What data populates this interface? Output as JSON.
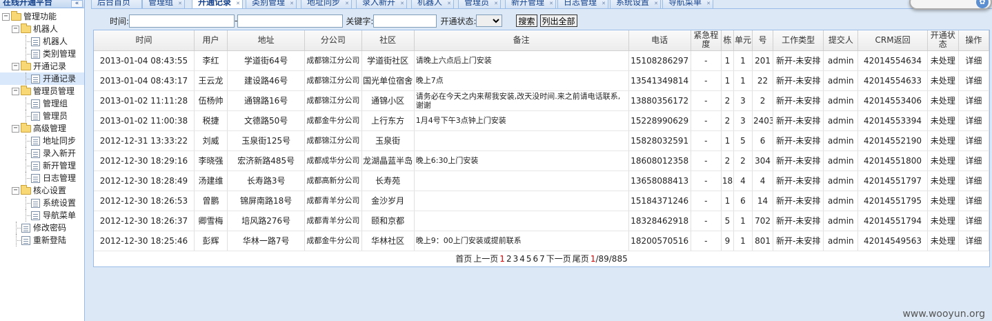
{
  "sidebar": {
    "title": "在线开通平台",
    "collapse_icon": "«",
    "root": "管理功能",
    "groups": [
      {
        "label": "机器人",
        "items": [
          "机器人",
          "类别管理"
        ]
      },
      {
        "label": "开通记录",
        "items": [
          "开通记录"
        ]
      },
      {
        "label": "管理员管理",
        "items": [
          "管理组",
          "管理员"
        ]
      },
      {
        "label": "高级管理",
        "items": [
          "地址同步",
          "录入新开",
          "新开管理",
          "日志管理"
        ]
      },
      {
        "label": "核心设置",
        "items": [
          "系统设置",
          "导航菜单"
        ]
      }
    ],
    "extra": [
      "修改密码",
      "重新登陆"
    ]
  },
  "tabs": [
    "后台首页",
    "管理组",
    "开通记录",
    "类别管理",
    "地址同步",
    "录入新开",
    "机器人",
    "管理员",
    "新开管理",
    "日志管理",
    "系统设置",
    "导航菜单"
  ],
  "active_tab": "开通记录",
  "search": {
    "time_label": "时间:",
    "dash": "-",
    "keyword_label": "关键字:",
    "status_label": "开通状态:",
    "search_button": "搜索",
    "list_all_button": "列出全部"
  },
  "table": {
    "headers": [
      "时间",
      "用户",
      "地址",
      "分公司",
      "社区",
      "备注",
      "电话",
      "紧急程度",
      "栋",
      "单元",
      "号",
      "工作类型",
      "提交人",
      "CRM返回",
      "开通状态",
      "操作"
    ],
    "rows": [
      [
        "2013-01-04 08:43:55",
        "李红",
        "学道街64号",
        "成都锦江分公司",
        "学道街社区",
        "请晚上六点后上门安装",
        "15108286297",
        "-",
        "1",
        "1",
        "201",
        "新开-未安排",
        "admin",
        "42014554634",
        "未处理",
        "详细"
      ],
      [
        "2013-01-04 08:43:17",
        "王云龙",
        "建设路46号",
        "成都锦江分公司",
        "国光单位宿舍",
        "晚上7点",
        "13541349814",
        "-",
        "1",
        "1",
        "22",
        "新开-未安排",
        "admin",
        "42014554633",
        "未处理",
        "详细"
      ],
      [
        "2013-01-02 11:11:28",
        "伍杨帅",
        "通锦路16号",
        "成都锦江分公司",
        "通锦小区",
        "请务必在今天之内来帮我安装,改天没时间.来之前请电话联系,谢谢",
        "13880356172",
        "-",
        "2",
        "3",
        "2",
        "新开-未安排",
        "admin",
        "42014553406",
        "未处理",
        "详细"
      ],
      [
        "2013-01-02 11:00:38",
        "税捷",
        "文德路50号",
        "成都金牛分公司",
        "上行东方",
        "1月4号下午3点钟上门安装",
        "15228990629",
        "-",
        "2",
        "3",
        "2403",
        "新开-未安排",
        "admin",
        "42014553394",
        "未处理",
        "详细"
      ],
      [
        "2012-12-31 13:33:22",
        "刘威",
        "玉泉街125号",
        "成都锦江分公司",
        "玉泉街",
        "",
        "15828032591",
        "-",
        "1",
        "5",
        "6",
        "新开-未安排",
        "admin",
        "42014552190",
        "未处理",
        "详细"
      ],
      [
        "2012-12-30 18:29:16",
        "李晓强",
        "宏济新路485号",
        "成都成华分公司",
        "龙湖晶蓝半岛",
        "晚上6:30上门安装",
        "18608012358",
        "-",
        "2",
        "2",
        "304",
        "新开-未安排",
        "admin",
        "42014551800",
        "未处理",
        "详细"
      ],
      [
        "2012-12-30 18:28:49",
        "汤建维",
        "长寿路3号",
        "成都高新分公司",
        "长寿苑",
        "",
        "13658088413",
        "-",
        "18",
        "4",
        "4",
        "新开-未安排",
        "admin",
        "42014551797",
        "未处理",
        "详细"
      ],
      [
        "2012-12-30 18:26:53",
        "曾鹏",
        "锦屏南路18号",
        "成都青羊分公司",
        "金沙岁月",
        "",
        "15184371246",
        "-",
        "1",
        "6",
        "14",
        "新开-未安排",
        "admin",
        "42014551795",
        "未处理",
        "详细"
      ],
      [
        "2012-12-30 18:26:37",
        "卿雪梅",
        "培风路276号",
        "成都青羊分公司",
        "颐和京都",
        "",
        "18328462918",
        "-",
        "5",
        "1",
        "702",
        "新开-未安排",
        "admin",
        "42014551794",
        "未处理",
        "详细"
      ],
      [
        "2012-12-30 18:25:46",
        "彭辉",
        "华林一路7号",
        "成都金牛分公司",
        "华林社区",
        "晚上9：00上门安装或提前联系",
        "18200570516",
        "-",
        "9",
        "1",
        "801",
        "新开-未安排",
        "admin",
        "42014549563",
        "未处理",
        "详细"
      ]
    ]
  },
  "pager": {
    "first": "首页",
    "prev": "上一页",
    "pages": [
      "1",
      "2",
      "3",
      "4",
      "5",
      "6",
      "7"
    ],
    "current": "1",
    "next": "下一页",
    "last": "尾页",
    "position": "1",
    "total": "/89/885"
  },
  "watermark": "www.wooyun.org"
}
